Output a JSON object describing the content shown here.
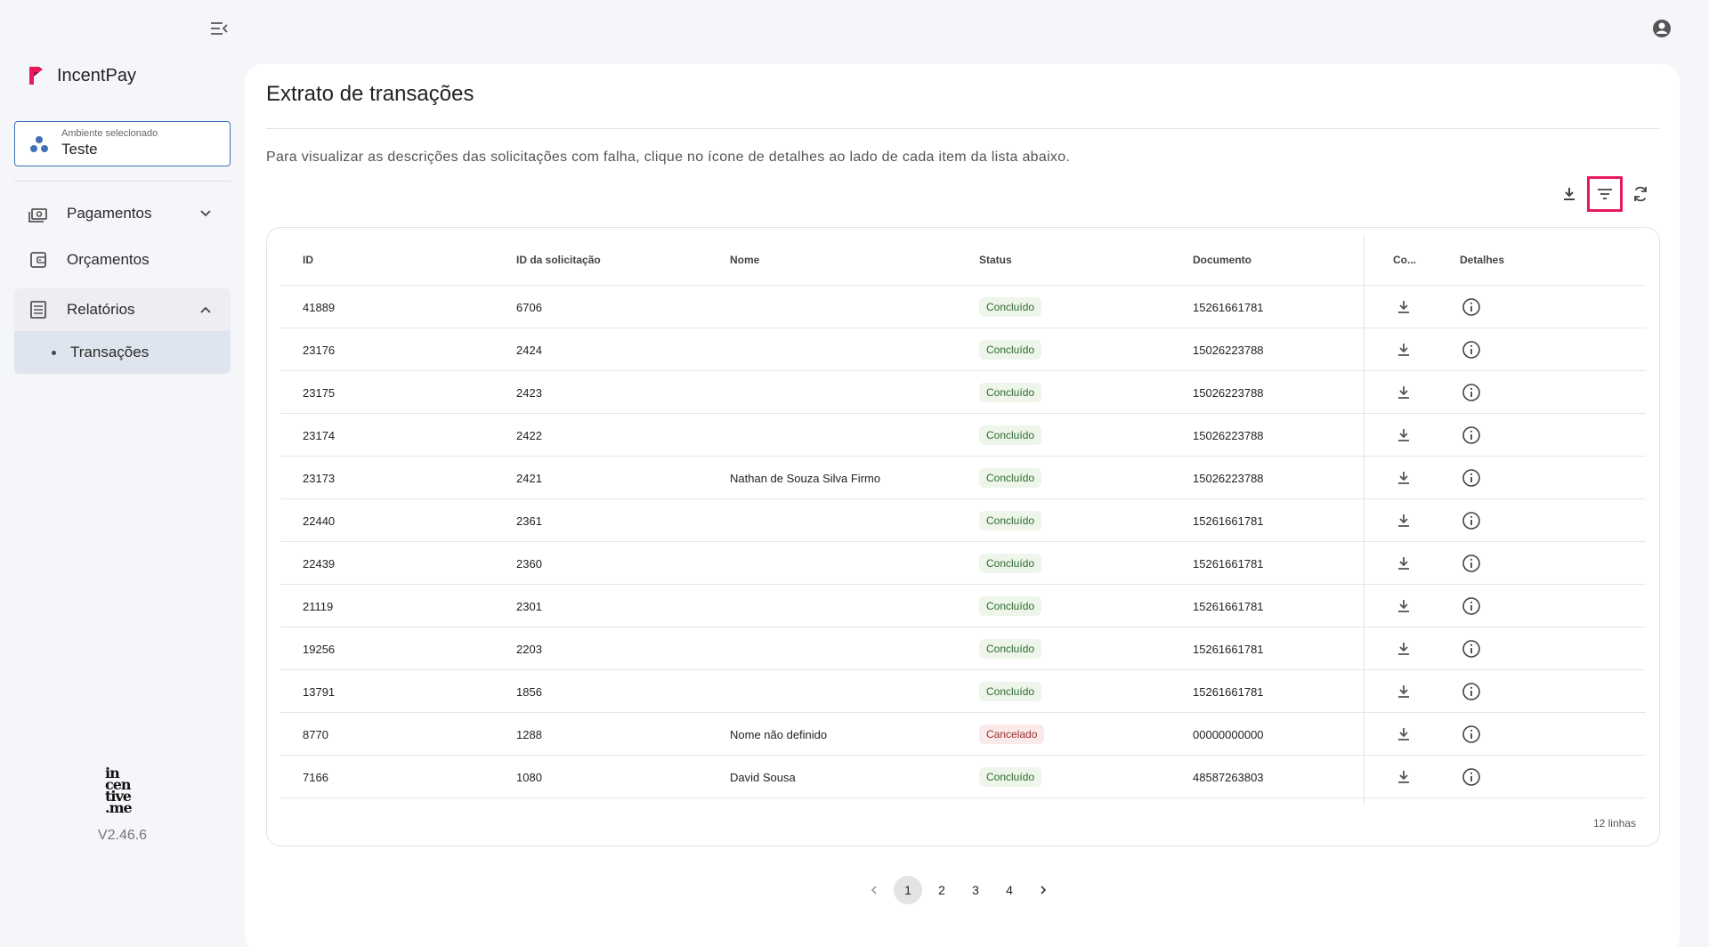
{
  "app": {
    "brand": "IncentPay",
    "environment_label": "Ambiente selecionado",
    "environment_value": "Teste",
    "version": "V2.46.6",
    "bottom_logo": [
      "in",
      "cen",
      "tive",
      ".me"
    ]
  },
  "sidebar": {
    "items": [
      {
        "label": "Pagamentos",
        "icon": "payments-icon"
      },
      {
        "label": "Orçamentos",
        "icon": "wallet-icon"
      },
      {
        "label": "Relatórios",
        "icon": "report-icon"
      }
    ],
    "sub_items": [
      {
        "label": "Transações"
      }
    ]
  },
  "page": {
    "title": "Extrato de transações",
    "info": "Para visualizar as descrições das solicitações com falha, clique no ícone de detalhes ao lado de cada item da lista abaixo."
  },
  "toolbar": {
    "icons": [
      "download-icon",
      "filter-icon",
      "refresh-icon"
    ],
    "active_accent": "#e8195a"
  },
  "table": {
    "headers": [
      "ID",
      "ID da solicitação",
      "Nome",
      "Status",
      "Documento",
      "Co...",
      "Detalhes"
    ],
    "rows": [
      {
        "id": "41889",
        "req": "6706",
        "name": "",
        "status": "Concluído",
        "status_type": "ok",
        "doc": "15261661781"
      },
      {
        "id": "23176",
        "req": "2424",
        "name": "",
        "status": "Concluído",
        "status_type": "ok",
        "doc": "15026223788"
      },
      {
        "id": "23175",
        "req": "2423",
        "name": "",
        "status": "Concluído",
        "status_type": "ok",
        "doc": "15026223788"
      },
      {
        "id": "23174",
        "req": "2422",
        "name": "",
        "status": "Concluído",
        "status_type": "ok",
        "doc": "15026223788"
      },
      {
        "id": "23173",
        "req": "2421",
        "name": "Nathan de Souza Silva Firmo",
        "status": "Concluído",
        "status_type": "ok",
        "doc": "15026223788"
      },
      {
        "id": "22440",
        "req": "2361",
        "name": "",
        "status": "Concluído",
        "status_type": "ok",
        "doc": "15261661781"
      },
      {
        "id": "22439",
        "req": "2360",
        "name": "",
        "status": "Concluído",
        "status_type": "ok",
        "doc": "15261661781"
      },
      {
        "id": "21119",
        "req": "2301",
        "name": "",
        "status": "Concluído",
        "status_type": "ok",
        "doc": "15261661781"
      },
      {
        "id": "19256",
        "req": "2203",
        "name": "",
        "status": "Concluído",
        "status_type": "ok",
        "doc": "15261661781"
      },
      {
        "id": "13791",
        "req": "1856",
        "name": "",
        "status": "Concluído",
        "status_type": "ok",
        "doc": "15261661781"
      },
      {
        "id": "8770",
        "req": "1288",
        "name": "Nome não definido",
        "status": "Cancelado",
        "status_type": "cancel",
        "doc": "00000000000"
      },
      {
        "id": "7166",
        "req": "1080",
        "name": "David Sousa",
        "status": "Concluído",
        "status_type": "ok",
        "doc": "48587263803"
      }
    ],
    "row_count": "12 linhas"
  },
  "pagination": {
    "pages": [
      "1",
      "2",
      "3",
      "4"
    ],
    "current": "1"
  }
}
